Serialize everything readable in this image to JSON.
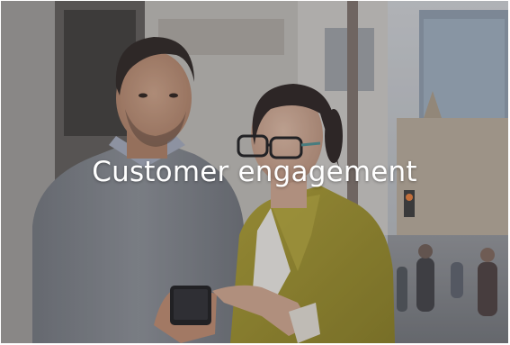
{
  "tile": {
    "title": "Customer engagement",
    "image_subject": "two-people-looking-at-phone-photo",
    "overlay_color": "#3c3e42"
  },
  "colors": {
    "caption_text": "#ffffff",
    "jacket": "#9b8e2b",
    "sweater": "#7c7f86"
  }
}
